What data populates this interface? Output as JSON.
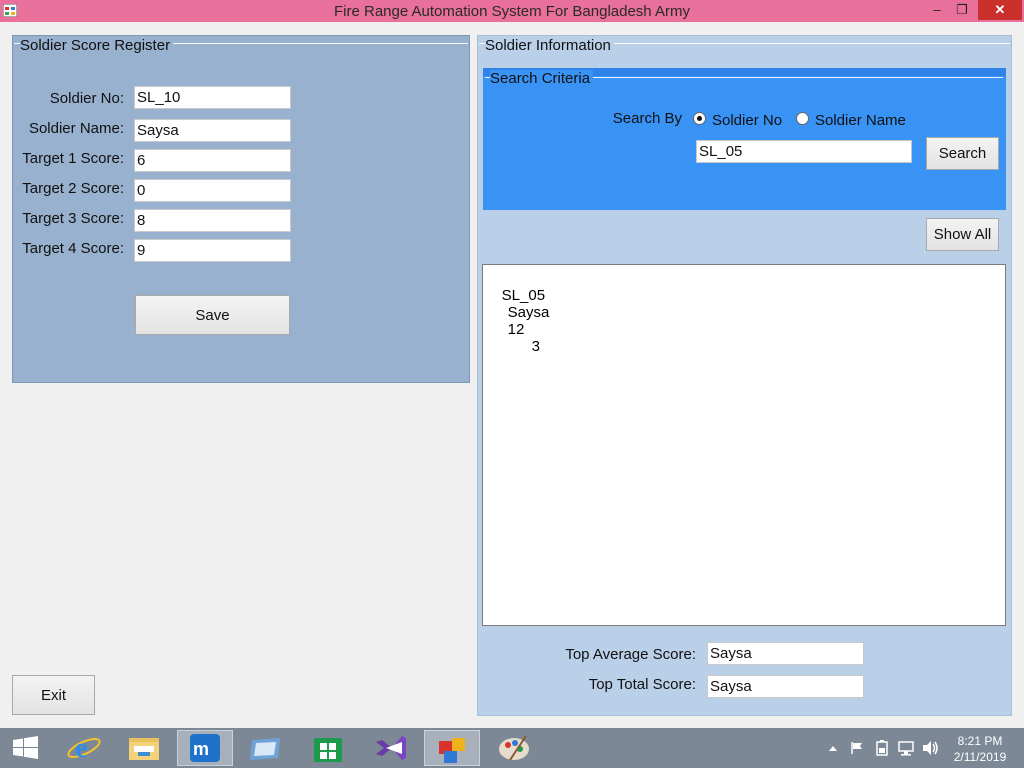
{
  "window": {
    "title": "Fire Range Automation System For Bangladesh Army",
    "minimize_glyph": "–",
    "maximize_glyph": "❐",
    "close_glyph": "✕"
  },
  "register": {
    "group_title": "Soldier Score Register",
    "fields": [
      {
        "label": "Soldier No:",
        "value": "SL_10"
      },
      {
        "label": "Soldier Name:",
        "value": "Saysa"
      },
      {
        "label": "Target 1 Score:",
        "value": "6"
      },
      {
        "label": "Target 2 Score:",
        "value": "0"
      },
      {
        "label": "Target 3 Score:",
        "value": "8"
      },
      {
        "label": "Target 4 Score:",
        "value": "9"
      }
    ],
    "save_label": "Save"
  },
  "info": {
    "group_title": "Soldier Information",
    "search": {
      "group_title": "Search Criteria",
      "search_by_label": "Search By",
      "options": [
        {
          "label": "Soldier No",
          "selected": true
        },
        {
          "label": "Soldier Name",
          "selected": false
        }
      ],
      "query": "SL_05",
      "button_label": "Search"
    },
    "show_all_label": "Show All",
    "results": [
      {
        "soldier_no": "SL_05",
        "name": "Saysa",
        "total": "12",
        "average": "3"
      }
    ],
    "top_average_label": "Top Average Score:",
    "top_average_value": "Saysa",
    "top_total_label": "Top Total Score:",
    "top_total_value": "Saysa"
  },
  "exit_label": "Exit",
  "taskbar": {
    "items": [
      {
        "icon": "start-icon"
      },
      {
        "icon": "internet-explorer-icon"
      },
      {
        "icon": "file-explorer-icon"
      },
      {
        "icon": "maxthon-browser-icon",
        "active": true
      },
      {
        "icon": "remote-app-icon"
      },
      {
        "icon": "store-icon"
      },
      {
        "icon": "visual-studio-icon"
      },
      {
        "icon": "running-app-icon",
        "active": true
      },
      {
        "icon": "paint-icon"
      }
    ],
    "time": "8:21 PM",
    "date": "2/11/2019"
  },
  "colors": {
    "titlebar": "#e8709a",
    "register_panel": "#98b1ce",
    "info_panel": "#bad0e8",
    "search_panel": "#3993f5",
    "taskbar": "#7d8896",
    "close_button": "#c9302c"
  }
}
